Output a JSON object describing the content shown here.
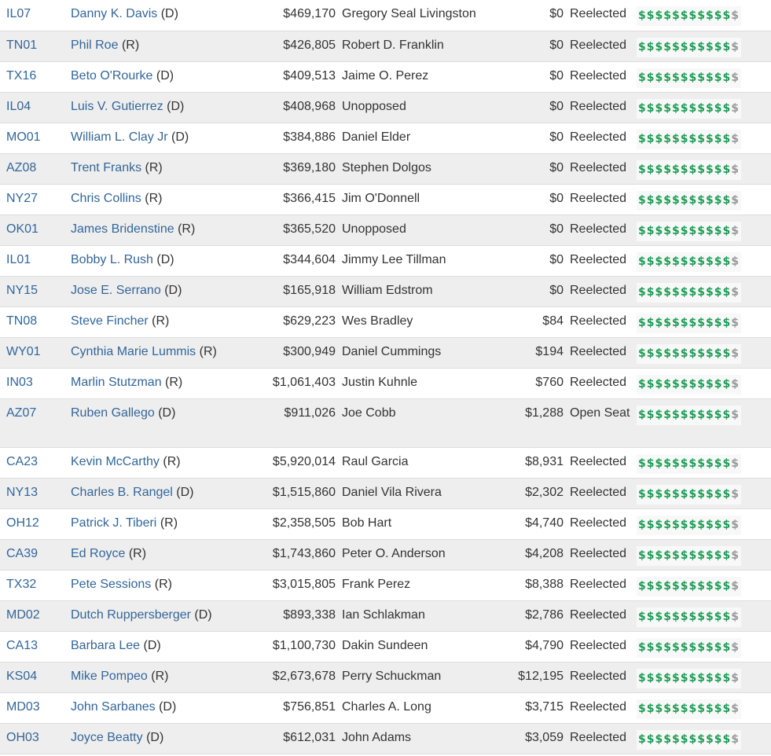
{
  "colors": {
    "link": "#336699",
    "dollar_green": "#1f9d55",
    "dollar_gray": "#999999"
  },
  "rows": [
    {
      "district": "IL07",
      "incumbent": "Danny K. Davis",
      "party": "(D)",
      "raised": "$469,170",
      "challenger": "Gregory Seal Livingston",
      "challenger_raised": "$0",
      "status": "Reelected",
      "meter": "$$$$$$$$$$$$",
      "meter_green": 11
    },
    {
      "district": "TN01",
      "incumbent": "Phil Roe",
      "party": "(R)",
      "raised": "$426,805",
      "challenger": "Robert D. Franklin",
      "challenger_raised": "$0",
      "status": "Reelected",
      "meter": "$$$$$$$$$$$$",
      "meter_green": 11
    },
    {
      "district": "TX16",
      "incumbent": "Beto O'Rourke",
      "party": "(D)",
      "raised": "$409,513",
      "challenger": "Jaime O. Perez",
      "challenger_raised": "$0",
      "status": "Reelected",
      "meter": "$$$$$$$$$$$$",
      "meter_green": 11
    },
    {
      "district": "IL04",
      "incumbent": "Luis V. Gutierrez",
      "party": "(D)",
      "raised": "$408,968",
      "challenger": "Unopposed",
      "challenger_raised": "$0",
      "status": "Reelected",
      "meter": "$$$$$$$$$$$$",
      "meter_green": 11
    },
    {
      "district": "MO01",
      "incumbent": "William L. Clay Jr",
      "party": "(D)",
      "raised": "$384,886",
      "challenger": "Daniel Elder",
      "challenger_raised": "$0",
      "status": "Reelected",
      "meter": "$$$$$$$$$$$$",
      "meter_green": 11
    },
    {
      "district": "AZ08",
      "incumbent": "Trent Franks",
      "party": "(R)",
      "raised": "$369,180",
      "challenger": "Stephen Dolgos",
      "challenger_raised": "$0",
      "status": "Reelected",
      "meter": "$$$$$$$$$$$$",
      "meter_green": 11
    },
    {
      "district": "NY27",
      "incumbent": "Chris Collins",
      "party": "(R)",
      "raised": "$366,415",
      "challenger": "Jim O'Donnell",
      "challenger_raised": "$0",
      "status": "Reelected",
      "meter": "$$$$$$$$$$$$",
      "meter_green": 11
    },
    {
      "district": "OK01",
      "incumbent": "James Bridenstine",
      "party": "(R)",
      "raised": "$365,520",
      "challenger": "Unopposed",
      "challenger_raised": "$0",
      "status": "Reelected",
      "meter": "$$$$$$$$$$$$",
      "meter_green": 11
    },
    {
      "district": "IL01",
      "incumbent": "Bobby L. Rush",
      "party": "(D)",
      "raised": "$344,604",
      "challenger": "Jimmy Lee Tillman",
      "challenger_raised": "$0",
      "status": "Reelected",
      "meter": "$$$$$$$$$$$$",
      "meter_green": 11
    },
    {
      "district": "NY15",
      "incumbent": "Jose E. Serrano",
      "party": "(D)",
      "raised": "$165,918",
      "challenger": "William Edstrom",
      "challenger_raised": "$0",
      "status": "Reelected",
      "meter": "$$$$$$$$$$$$",
      "meter_green": 11
    },
    {
      "district": "TN08",
      "incumbent": "Steve Fincher",
      "party": "(R)",
      "raised": "$629,223",
      "challenger": "Wes Bradley",
      "challenger_raised": "$84",
      "status": "Reelected",
      "meter": "$$$$$$$$$$$$",
      "meter_green": 11
    },
    {
      "district": "WY01",
      "incumbent": "Cynthia Marie Lummis",
      "party": "(R)",
      "raised": "$300,949",
      "challenger": "Daniel Cummings",
      "challenger_raised": "$194",
      "status": "Reelected",
      "meter": "$$$$$$$$$$$$",
      "meter_green": 11
    },
    {
      "district": "IN03",
      "incumbent": "Marlin Stutzman",
      "party": "(R)",
      "raised": "$1,061,403",
      "challenger": "Justin Kuhnle",
      "challenger_raised": "$760",
      "status": "Reelected",
      "meter": "$$$$$$$$$$$$",
      "meter_green": 11
    },
    {
      "district": "AZ07",
      "incumbent": "Ruben Gallego",
      "party": "(D)",
      "raised": "$911,026",
      "challenger": "Joe Cobb",
      "challenger_raised": "$1,288",
      "status": "Open Seat",
      "meter": "$$$$$$$$$$$$",
      "meter_green": 11
    },
    {
      "district": "CA23",
      "incumbent": "Kevin McCarthy",
      "party": "(R)",
      "raised": "$5,920,014",
      "challenger": "Raul Garcia",
      "challenger_raised": "$8,931",
      "status": "Reelected",
      "meter": "$$$$$$$$$$$$",
      "meter_green": 11
    },
    {
      "district": "NY13",
      "incumbent": "Charles B. Rangel",
      "party": "(D)",
      "raised": "$1,515,860",
      "challenger": "Daniel Vila Rivera",
      "challenger_raised": "$2,302",
      "status": "Reelected",
      "meter": "$$$$$$$$$$$$",
      "meter_green": 11
    },
    {
      "district": "OH12",
      "incumbent": "Patrick J. Tiberi",
      "party": "(R)",
      "raised": "$2,358,505",
      "challenger": "Bob Hart",
      "challenger_raised": "$4,740",
      "status": "Reelected",
      "meter": "$$$$$$$$$$$$",
      "meter_green": 11
    },
    {
      "district": "CA39",
      "incumbent": "Ed Royce",
      "party": "(R)",
      "raised": "$1,743,860",
      "challenger": "Peter O. Anderson",
      "challenger_raised": "$4,208",
      "status": "Reelected",
      "meter": "$$$$$$$$$$$$",
      "meter_green": 11
    },
    {
      "district": "TX32",
      "incumbent": "Pete Sessions",
      "party": "(R)",
      "raised": "$3,015,805",
      "challenger": "Frank Perez",
      "challenger_raised": "$8,388",
      "status": "Reelected",
      "meter": "$$$$$$$$$$$$",
      "meter_green": 11
    },
    {
      "district": "MD02",
      "incumbent": "Dutch Ruppersberger",
      "party": "(D)",
      "raised": "$893,338",
      "challenger": "Ian Schlakman",
      "challenger_raised": "$2,786",
      "status": "Reelected",
      "meter": "$$$$$$$$$$$$",
      "meter_green": 11
    },
    {
      "district": "CA13",
      "incumbent": "Barbara Lee",
      "party": "(D)",
      "raised": "$1,100,730",
      "challenger": "Dakin Sundeen",
      "challenger_raised": "$4,790",
      "status": "Reelected",
      "meter": "$$$$$$$$$$$$",
      "meter_green": 11
    },
    {
      "district": "KS04",
      "incumbent": "Mike Pompeo",
      "party": "(R)",
      "raised": "$2,673,678",
      "challenger": "Perry Schuckman",
      "challenger_raised": "$12,195",
      "status": "Reelected",
      "meter": "$$$$$$$$$$$$",
      "meter_green": 11
    },
    {
      "district": "MD03",
      "incumbent": "John Sarbanes",
      "party": "(D)",
      "raised": "$756,851",
      "challenger": "Charles A. Long",
      "challenger_raised": "$3,715",
      "status": "Reelected",
      "meter": "$$$$$$$$$$$$",
      "meter_green": 11
    },
    {
      "district": "OH03",
      "incumbent": "Joyce Beatty",
      "party": "(D)",
      "raised": "$612,031",
      "challenger": "John Adams",
      "challenger_raised": "$3,059",
      "status": "Reelected",
      "meter": "$$$$$$$$$$$$",
      "meter_green": 11
    }
  ]
}
